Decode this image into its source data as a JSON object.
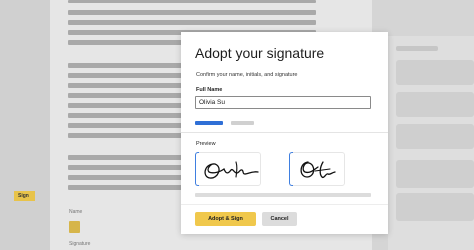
{
  "document": {
    "sign_tag": "Sign",
    "name_label": "Name",
    "signature_label": "Signature"
  },
  "modal": {
    "title": "Adopt your signature",
    "subtitle": "Confirm your name, initials, and signature",
    "full_name_label": "Full Name",
    "full_name_value": "Olivia Su",
    "preview_label": "Preview",
    "adopt_button": "Adopt & Sign",
    "cancel_button": "Cancel"
  },
  "colors": {
    "accent_blue": "#2f6fd6",
    "button_yellow": "#f0c84c",
    "sign_tag_yellow": "#e8c34a"
  }
}
